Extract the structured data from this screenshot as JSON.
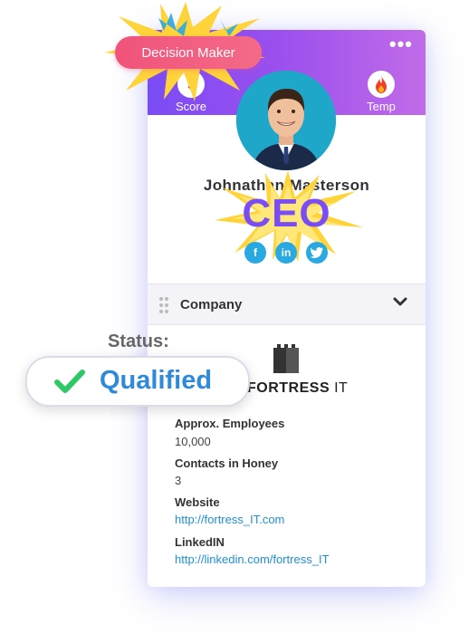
{
  "badge": {
    "label": "Decision Maker"
  },
  "card": {
    "menu_dots": "•••",
    "score": {
      "value": "5",
      "label": "Score"
    },
    "temp": {
      "label": "Temp",
      "icon": "fire-icon"
    },
    "name": "Johnathan Masterson",
    "title": "CEO",
    "socials": [
      {
        "icon": "facebook-icon",
        "glyph": "f"
      },
      {
        "icon": "linkedin-icon",
        "glyph": "in"
      },
      {
        "icon": "twitter-icon",
        "glyph": "t"
      }
    ],
    "section_label": "Company",
    "company": {
      "logo_name_bold": "FORTRESS",
      "logo_name_rest": " IT"
    },
    "fields": {
      "employees_label": "Approx. Employees",
      "employees_value": "10,000",
      "contacts_label": "Contacts in Honey",
      "contacts_value": "3",
      "website_label": "Website",
      "website_value": "http://fortress_IT.com",
      "linkedin_label": "LinkedIN",
      "linkedin_value": "http://linkedin.com/fortress_IT"
    }
  },
  "status": {
    "label": "Status:",
    "value": "Qualified"
  },
  "colors": {
    "purple": "#7a4cf5",
    "pink": "#f0537a",
    "blue": "#2f8ad9",
    "green": "#2ec866",
    "link": "#1f8fd6"
  }
}
